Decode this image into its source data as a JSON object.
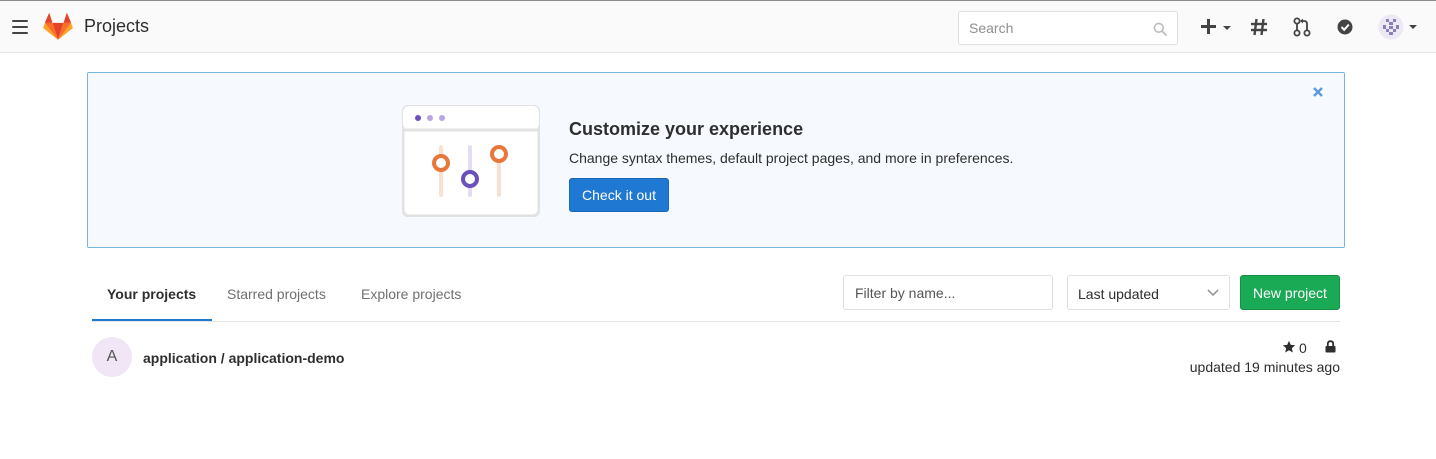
{
  "navbar": {
    "title": "Projects",
    "search_placeholder": "Search",
    "icons": [
      "menu-icon",
      "gitlab-logo",
      "search-icon",
      "plus-icon",
      "issues-hash-icon",
      "merge-request-icon",
      "todo-check-icon",
      "user-avatar"
    ]
  },
  "banner": {
    "title": "Customize your experience",
    "text": "Change syntax themes, default project pages, and more in preferences.",
    "button_label": "Check it out"
  },
  "tabs": [
    {
      "label": "Your projects",
      "active": true
    },
    {
      "label": "Starred projects",
      "active": false
    },
    {
      "label": "Explore projects",
      "active": false
    }
  ],
  "filter": {
    "placeholder": "Filter by name..."
  },
  "sort": {
    "selected": "Last updated"
  },
  "new_project_label": "New project",
  "projects": [
    {
      "avatar_letter": "A",
      "name": "application / application-demo",
      "stars": "0",
      "updated": "updated 19 minutes ago",
      "visibility": "private"
    }
  ],
  "colors": {
    "primary": "#1f78d1",
    "success": "#1aaa55",
    "banner_bg": "#f6fafe",
    "banner_border": "#78b4e0",
    "orange": "#e8773c",
    "purple": "#6b4fbb"
  }
}
